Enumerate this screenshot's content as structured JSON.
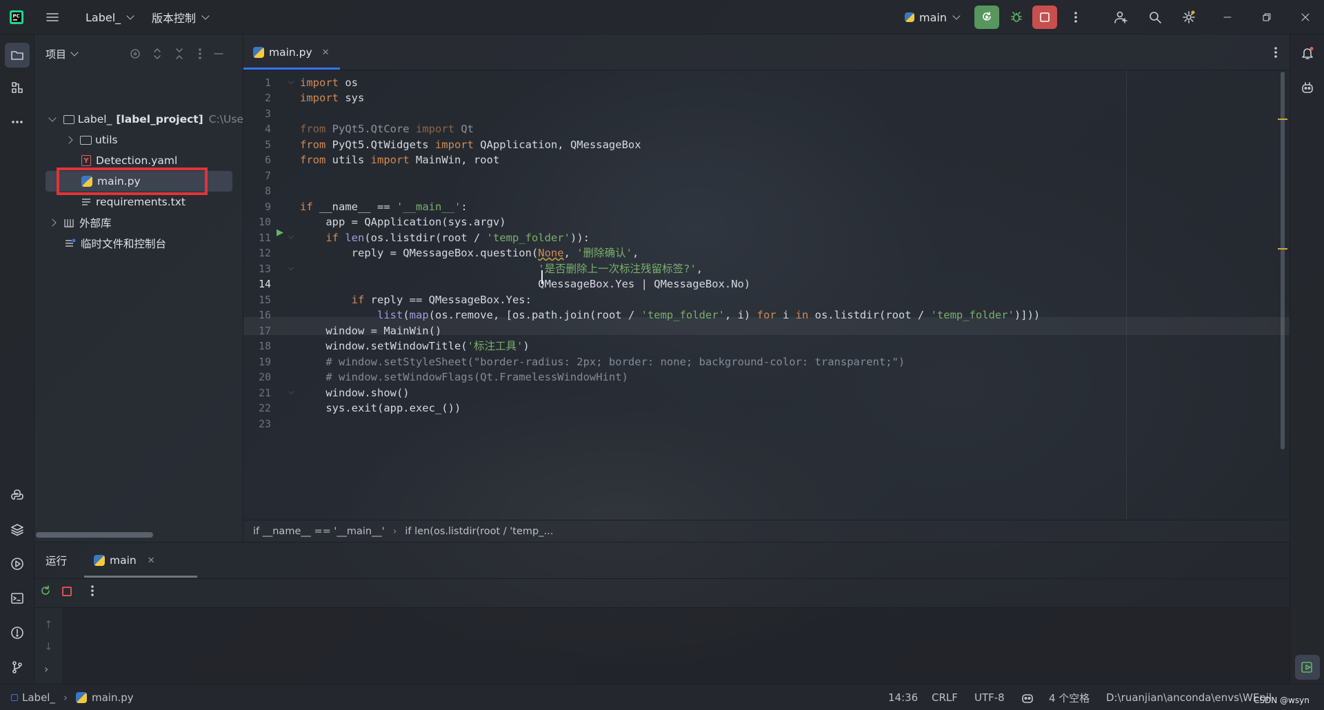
{
  "titlebar": {
    "project_label": "Label_",
    "vcs_label": "版本控制",
    "run_config": "main"
  },
  "project_panel": {
    "title": "项目",
    "root_name": "Label_",
    "root_module": "[label_project]",
    "root_path": "C:\\Use",
    "items": [
      {
        "label": "utils",
        "type": "folder"
      },
      {
        "label": "Detection.yaml",
        "type": "yaml"
      },
      {
        "label": "main.py",
        "type": "python",
        "selected": true
      },
      {
        "label": "requirements.txt",
        "type": "text"
      }
    ],
    "external_libs": "外部库",
    "scratches": "临时文件和控制台"
  },
  "editor": {
    "tab_label": "main.py",
    "current_line": 14,
    "line_numbers": [
      "1",
      "2",
      "3",
      "4",
      "5",
      "6",
      "7",
      "8",
      "9",
      "10",
      "11",
      "12",
      "13",
      "14",
      "15",
      "16",
      "17",
      "18",
      "19",
      "20",
      "21",
      "22",
      "23"
    ]
  },
  "breadcrumb": {
    "part1": "if __name__ == '__main__'",
    "part2": "if len(os.listdir(root / 'temp_..."
  },
  "run_panel": {
    "title": "运行",
    "tab_label": "main"
  },
  "statusbar": {
    "project": "Label_",
    "file": "main.py",
    "position": "14:36",
    "line_sep": "CRLF",
    "encoding": "UTF-8",
    "indent": "4 个空格",
    "interpreter": "D:\\ruanjian\\anconda\\envs\\WEnil",
    "watermark": "CSDN @wsyn"
  },
  "colors": {
    "accent": "#3574f0",
    "run_green": "#57965c",
    "stop_red": "#c94f4f",
    "highlight_box": "#e0343a"
  }
}
